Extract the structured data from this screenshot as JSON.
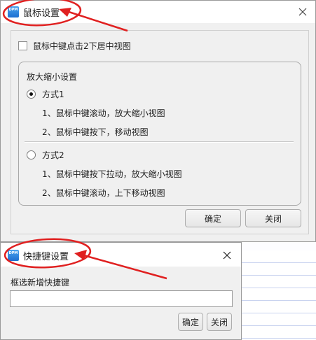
{
  "app_icon_text": "DPM",
  "mouse_dialog": {
    "title": "鼠标设置",
    "center_checkbox_label": "鼠标中键点击2下居中视图",
    "zoom_group_title": "放大缩小设置",
    "option1": {
      "label": "方式1",
      "selected": true,
      "line1": "1、鼠标中键滚动，放大缩小视图",
      "line2": "2、鼠标中键按下，移动视图"
    },
    "option2": {
      "label": "方式2",
      "selected": false,
      "line1": "1、鼠标中键按下拉动，放大缩小视图",
      "line2": "2、鼠标中键滚动，上下移动视图"
    },
    "ok_label": "确定",
    "close_label": "关闭"
  },
  "shortcut_dialog": {
    "title": "快捷键设置",
    "field_label": "框选新增快捷键",
    "field_value": "",
    "ok_label": "确定",
    "close_label": "关闭"
  },
  "colors": {
    "annotation_red": "#e02020",
    "icon_blue": "#1e6fd0"
  }
}
